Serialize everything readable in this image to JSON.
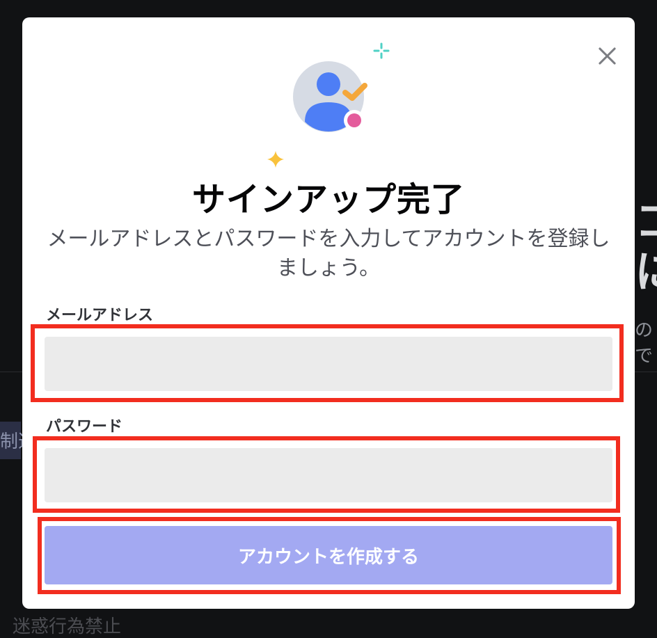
{
  "background": {
    "big_line_1": "コ",
    "big_line_2": "に",
    "small_line": "ので",
    "chip_text": "制週",
    "bottom_text": "迷惑行為禁止"
  },
  "modal": {
    "close_icon": "close-icon",
    "hero_icon": "user-avatar-check-icon",
    "title": "サインアップ完了",
    "subtitle": "メールアドレスとパスワードを入力してアカウントを登録しましょう。",
    "email": {
      "label": "メールアドレス",
      "value": "",
      "placeholder": ""
    },
    "password": {
      "label": "パスワード",
      "value": "",
      "placeholder": ""
    },
    "submit_label": "アカウントを作成する"
  },
  "colors": {
    "accent_button": "#a3a9f2",
    "highlight": "#f22d1f",
    "avatar_blue": "#4e7ef5",
    "check_orange": "#f4a73b",
    "status_pink": "#e45c9c"
  }
}
